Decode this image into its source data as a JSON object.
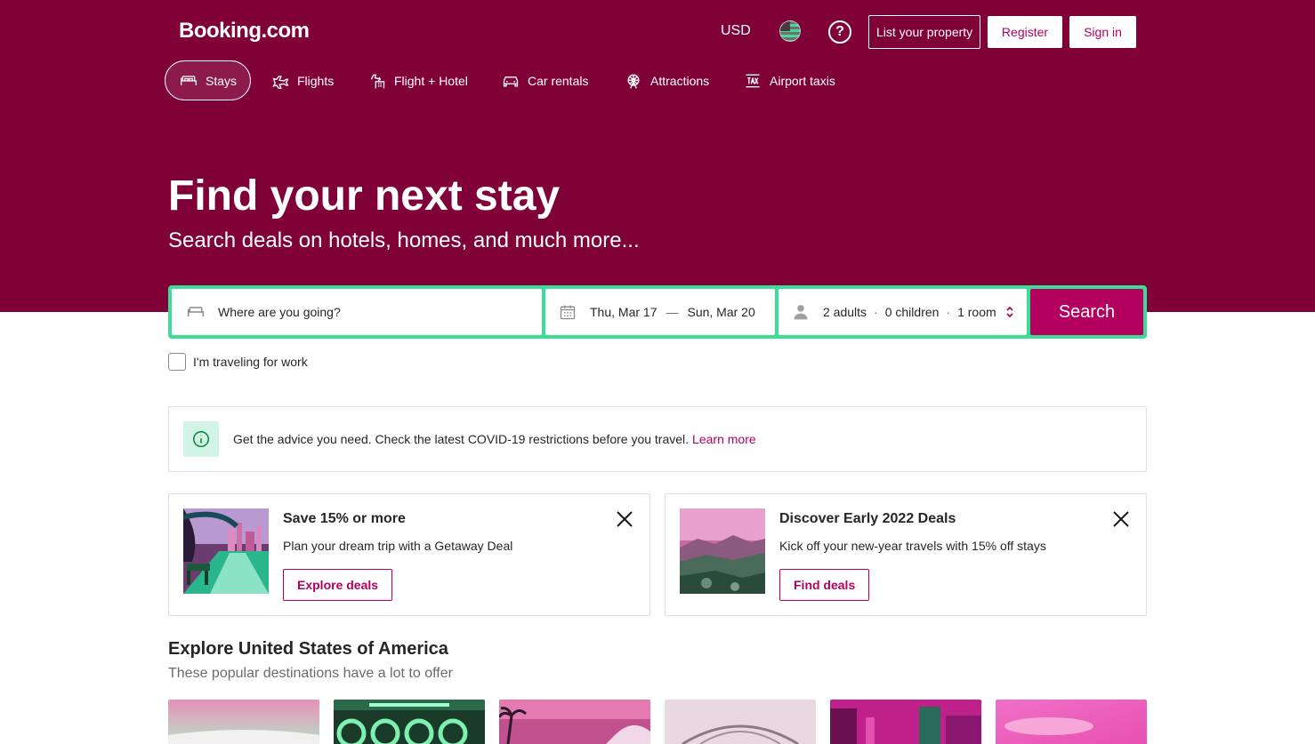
{
  "header": {
    "logo": "Booking.com",
    "currency": "USD",
    "language_flag": "us-flag-icon",
    "help_icon": "?",
    "list_property": "List your property",
    "register": "Register",
    "sign_in": "Sign in"
  },
  "nav": {
    "items": [
      {
        "label": "Stays",
        "icon": "bed-icon",
        "active": true
      },
      {
        "label": "Flights",
        "icon": "plane-icon",
        "active": false
      },
      {
        "label": "Flight + Hotel",
        "icon": "plane-hotel-icon",
        "active": false
      },
      {
        "label": "Car rentals",
        "icon": "car-icon",
        "active": false
      },
      {
        "label": "Attractions",
        "icon": "ferris-wheel-icon",
        "active": false
      },
      {
        "label": "Airport taxis",
        "icon": "taxi-icon",
        "active": false
      }
    ]
  },
  "hero": {
    "title": "Find your next stay",
    "subtitle": "Search deals on hotels, homes, and much more..."
  },
  "search": {
    "destination_placeholder": "Where are you going?",
    "checkin": "Thu, Mar 17",
    "date_separator": "—",
    "checkout": "Sun, Mar 20",
    "adults": "2 adults",
    "children": "0 children",
    "rooms": "1 room",
    "dot": "·",
    "button": "Search",
    "work_label": "I'm traveling for work"
  },
  "covid": {
    "text": "Get the advice you need. Check the latest COVID-19 restrictions before you travel.",
    "link": "Learn more"
  },
  "deals": [
    {
      "title": "Save 15% or more",
      "text": "Plan your dream trip with a Getaway Deal",
      "button": "Explore deals"
    },
    {
      "title": "Discover Early 2022 Deals",
      "text": "Kick off your new-year travels with 15% off stays",
      "button": "Find deals"
    }
  ],
  "explore": {
    "title": "Explore United States of America",
    "subtitle": "These popular destinations have a lot to offer"
  },
  "colors": {
    "brand": "#800038",
    "accent": "#b3005f",
    "searchbar_border": "#3ddc97"
  }
}
